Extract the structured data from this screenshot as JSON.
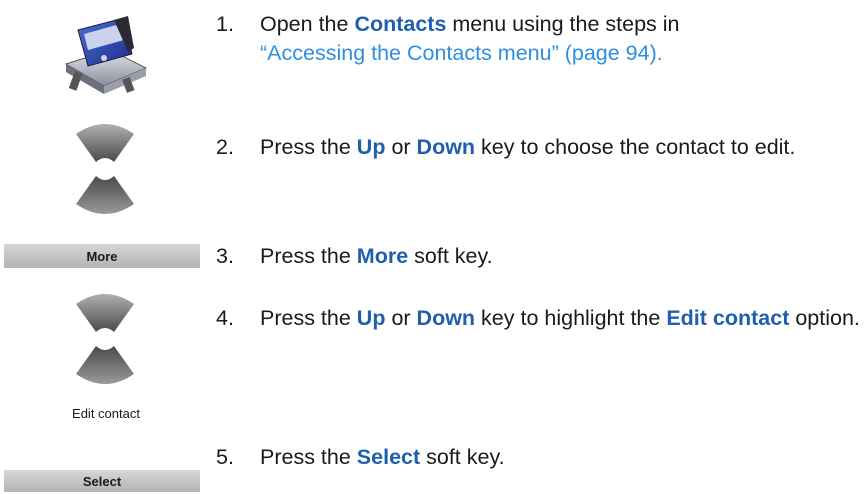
{
  "icons": {
    "phone": "cordless-phone-charger-icon",
    "nav_up": "nav-up-key-icon",
    "nav_down": "nav-down-key-icon"
  },
  "colors": {
    "keyword": "#1f5fae",
    "link": "#2f8ee0",
    "softkey": "#c4c4c4"
  },
  "steps": [
    {
      "num": "1.",
      "pre": "Open the ",
      "kw1": "Contacts",
      "mid": " menu using the steps in ",
      "link": "“Accessing the Contacts menu” (page 94)",
      "post": "."
    },
    {
      "num": "2.",
      "pre": "Press the ",
      "kw1": "Up",
      "mid": " or ",
      "kw2": "Down",
      "post": " key to choose the contact to edit."
    },
    {
      "num": "3.",
      "pre": "Press the ",
      "kw1": "More",
      "post": " soft key."
    },
    {
      "num": "4.",
      "pre": "Press the ",
      "kw1": "Up",
      "mid": " or ",
      "kw2": "Down",
      "mid2": " key to highlight the ",
      "kw3": "Edit contact",
      "post": " option."
    },
    {
      "num": "5.",
      "pre": "Press the ",
      "kw1": "Select",
      "post": " soft key."
    }
  ],
  "softkeys": {
    "more": "More",
    "select": "Select"
  },
  "screen_caption": "Edit contact"
}
